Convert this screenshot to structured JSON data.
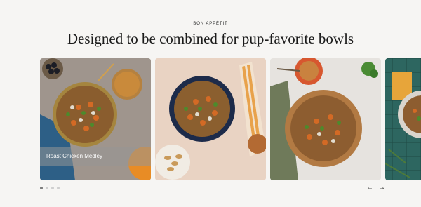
{
  "section": {
    "eyebrow": "BON APPÉTIT",
    "headline": "Designed to be combined for pup-favorite bowls"
  },
  "carousel": {
    "cards": [
      {
        "caption": "Roast Chicken Medley",
        "image": "roast-chicken-medley-bowl-photo"
      },
      {
        "image": "navy-bowl-with-peanuts-photo"
      },
      {
        "image": "wooden-bowl-on-marble-photo"
      },
      {
        "image": "teal-tile-bowl-photo"
      }
    ],
    "pagination": {
      "count": 4,
      "active": 1
    },
    "controls": {
      "prev": "←",
      "next": "→"
    }
  },
  "colors": {
    "background": "#f6f5f3",
    "text": "#1e1e1e"
  }
}
